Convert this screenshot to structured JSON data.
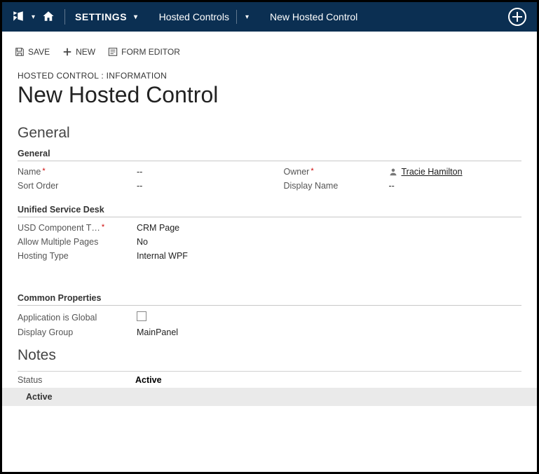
{
  "nav": {
    "settings_label": "SETTINGS",
    "crumb1": "Hosted Controls",
    "crumb2": "New Hosted Control"
  },
  "cmd": {
    "save": "SAVE",
    "new": "NEW",
    "form_editor": "FORM EDITOR"
  },
  "header": {
    "info": "HOSTED CONTROL : INFORMATION",
    "title": "New Hosted Control"
  },
  "sections": {
    "general": "General",
    "notes": "Notes"
  },
  "subsections": {
    "general": "General",
    "usd": "Unified Service Desk",
    "common": "Common Properties"
  },
  "fields": {
    "name_label": "Name",
    "name_value": "--",
    "sort_order_label": "Sort Order",
    "sort_order_value": "--",
    "owner_label": "Owner",
    "owner_value": "Tracie Hamilton",
    "display_name_label": "Display Name",
    "display_name_value": "--",
    "usd_component_label": "USD Component T…",
    "usd_component_value": "CRM Page",
    "allow_multi_label": "Allow Multiple Pages",
    "allow_multi_value": "No",
    "hosting_type_label": "Hosting Type",
    "hosting_type_value": "Internal WPF",
    "app_global_label": "Application is Global",
    "display_group_label": "Display Group",
    "display_group_value": "MainPanel"
  },
  "status": {
    "label": "Status",
    "value": "Active",
    "sub": "Active"
  }
}
